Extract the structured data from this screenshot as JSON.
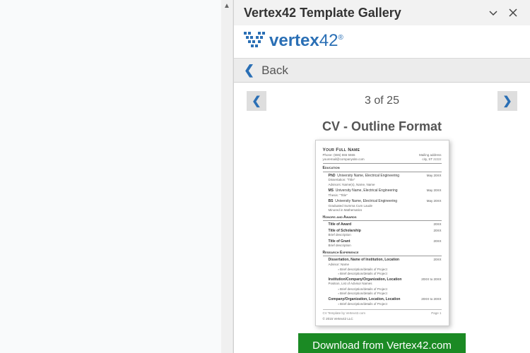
{
  "panel": {
    "title": "Vertex42 Template Gallery",
    "logo_text_prefix": "vertex",
    "logo_text_suffix": "42",
    "back_label": "Back"
  },
  "pager": {
    "current": 3,
    "total": 25,
    "label": "3 of 25"
  },
  "template": {
    "title": "CV - Outline Format"
  },
  "download": {
    "label": "Download from Vertex42.com"
  },
  "preview": {
    "name": "Your Full Name",
    "contact_left_1": "Phone: (555) 555 5555",
    "contact_left_2": "youremail@companysite.com",
    "contact_right_1": "Mailing address",
    "contact_right_2": "city, ST  zzzzz",
    "section_education": "Education",
    "edu": [
      {
        "degree": "PhD",
        "line1": "University Name, Electrical Engineering",
        "line2": "Dissertation: \"Title\"",
        "line3": "Advisors: Name(s), Name, Name",
        "date": "May 20XX"
      },
      {
        "degree": "MS",
        "line1": "University Name, Electrical Engineering",
        "line2": "Thesis: \"Title\"",
        "line3": "",
        "date": "May 20XX"
      },
      {
        "degree": "BS",
        "line1": "University Name, Electrical Engineering",
        "line2": "Graduated Summa Cum Laude",
        "line3": "Minored in Mathematics",
        "date": "May 20XX"
      }
    ],
    "section_honors": "Honors and Awards",
    "honors": [
      {
        "title": "Title of Award",
        "desc": "",
        "date": "20XX"
      },
      {
        "title": "Title of Scholarship",
        "desc": "Brief description",
        "date": "20XX"
      },
      {
        "title": "Title of Grant",
        "desc": "Brief description",
        "date": "20XX"
      }
    ],
    "section_research": "Research Experience",
    "research": [
      {
        "title": "Dissertation, Name of Institution, Location",
        "sub": "Advisor: Name",
        "bullets": [
          "Brief description/details of Project",
          "Brief description/details of Project"
        ],
        "date": "20XX"
      },
      {
        "title": "Institution/Company/Organization, Location",
        "sub": "Position, List of Advisor Names",
        "bullets": [
          "Brief description/details of Project",
          "Brief description/details of Project"
        ],
        "date": "20XX to 20XX"
      },
      {
        "title": "Company/Organization, Location, Location",
        "sub": "",
        "bullets": [
          "Brief description/details of Project"
        ],
        "date": "20XX to 20XX"
      }
    ],
    "footer_left": "CV Template by Vertex42.com",
    "footer_right": "Page   1",
    "copyright": "© 2015 Vertex42 LLC"
  }
}
